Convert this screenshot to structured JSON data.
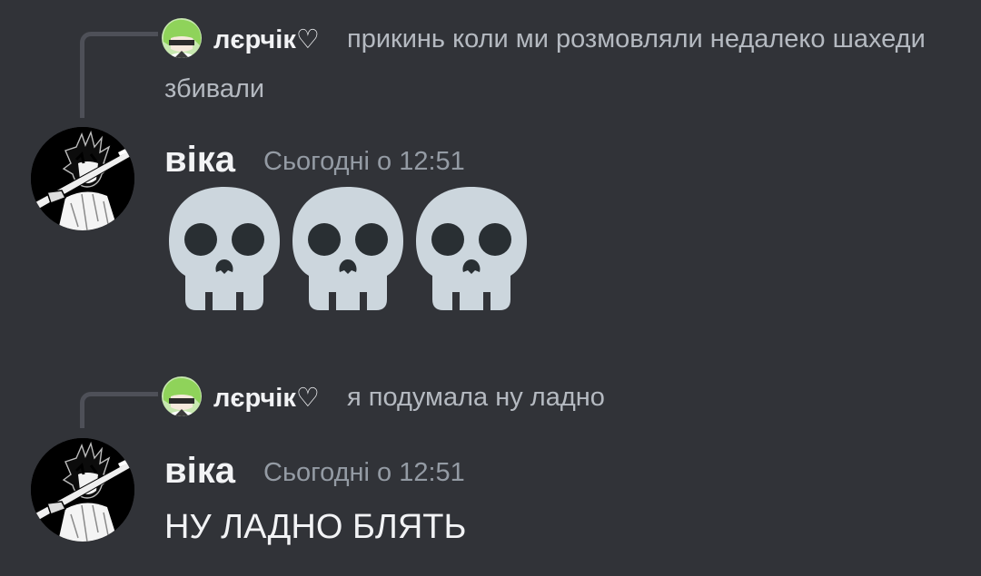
{
  "messages": [
    {
      "reply": {
        "author": "лєрчік♡",
        "text": "прикинь коли ми розмовляли недалеко шахеди збивали"
      },
      "author": "віка",
      "timestamp": "Сьогодні о 12:51",
      "emoji_icons": [
        "skull-icon",
        "skull-icon",
        "skull-icon"
      ]
    },
    {
      "reply": {
        "author": "лєрчік♡",
        "text": "я подумала ну ладно"
      },
      "author": "віка",
      "timestamp": "Сьогодні о 12:51",
      "text": "НУ ЛАДНО БЛЯТЬ"
    }
  ],
  "colors": {
    "background": "#313338",
    "author": "#f2f3f5",
    "reply_text": "#b5bac1",
    "timestamp": "#949ba4",
    "skull": "#ccd6dd",
    "avatar_hair": "#8fd35a"
  }
}
